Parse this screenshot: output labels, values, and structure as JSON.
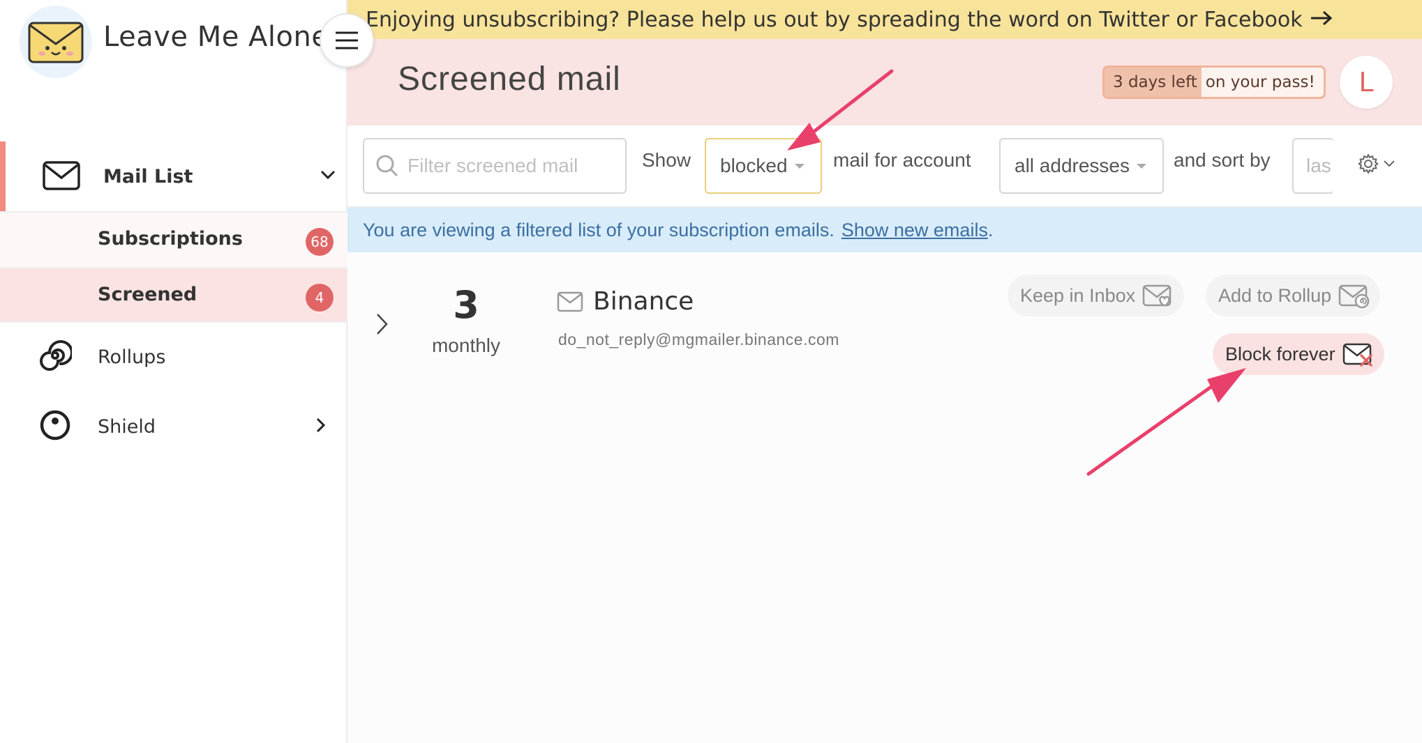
{
  "app": {
    "name": "Leave Me Alone"
  },
  "sidebar": {
    "items": [
      {
        "label": "Mail List"
      },
      {
        "label": "Subscriptions",
        "badge": "68"
      },
      {
        "label": "Screened",
        "badge": "4"
      },
      {
        "label": "Rollups"
      },
      {
        "label": "Shield"
      }
    ]
  },
  "banner": {
    "text": "Enjoying unsubscribing? Please help us out by spreading the word on Twitter or Facebook"
  },
  "header": {
    "title": "Screened mail",
    "pass_part1": "3 days left",
    "pass_part2": "on your pass!",
    "avatar_initial": "L"
  },
  "filter": {
    "search_placeholder": "Filter screened mail",
    "show_label": "Show",
    "show_value": "blocked",
    "account_label": "mail for account",
    "account_value": "all addresses",
    "sort_label": "and sort by",
    "sort_value": "las"
  },
  "info": {
    "text": "You are viewing a filtered list of your subscription emails.",
    "link": "Show new emails",
    "suffix": "."
  },
  "list": {
    "rows": [
      {
        "count": "3",
        "frequency": "monthly",
        "sender": "Binance",
        "email": "do_not_reply@mgmailer.binance.com",
        "actions": {
          "keep": "Keep in Inbox",
          "rollup": "Add to Rollup",
          "block": "Block forever"
        }
      }
    ]
  },
  "colors": {
    "accent": "#e06666",
    "banner": "#f8e39a",
    "header": "#fae3e3",
    "info": "#d8ecfa",
    "annotation": "#e8406b"
  }
}
